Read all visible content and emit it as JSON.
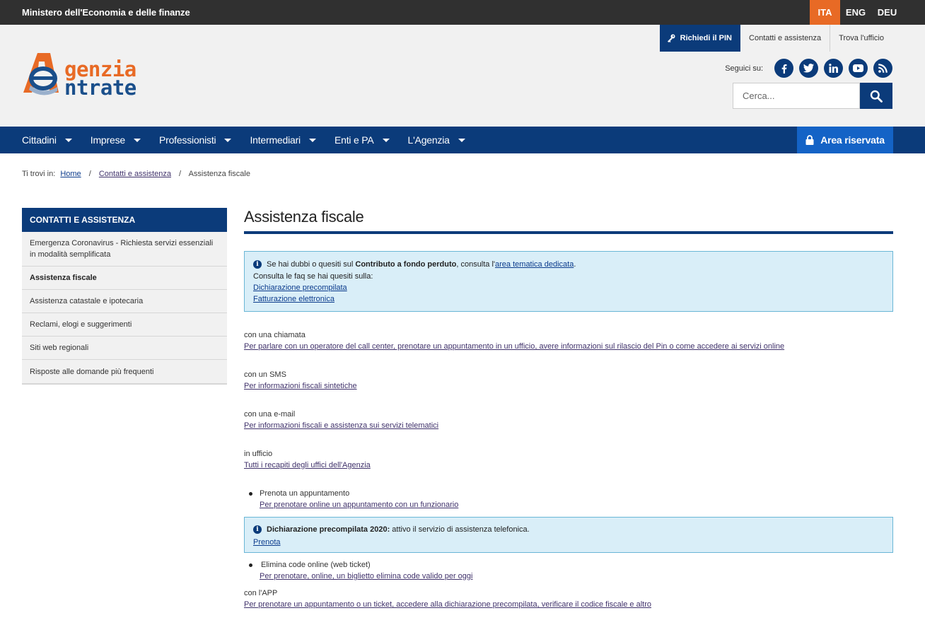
{
  "topbar": {
    "ministry": "Ministero dell'Economia e delle finanze",
    "languages": [
      "ITA",
      "ENG",
      "DEU"
    ],
    "active_color": "#e86a25"
  },
  "logo": {
    "part1": "genzia",
    "part2": "ntrate"
  },
  "util": {
    "pin": "Richiedi il PIN",
    "contacts": "Contatti e assistenza",
    "office": "Trova l'ufficio"
  },
  "social": {
    "label": "Seguici su:",
    "icons": [
      "facebook-icon",
      "twitter-icon",
      "linkedin-icon",
      "youtube-icon",
      "rss-icon"
    ]
  },
  "search": {
    "placeholder": "Cerca..."
  },
  "nav": {
    "items": [
      "Cittadini",
      "Imprese",
      "Professionisti",
      "Intermediari",
      "Enti e PA",
      "L'Agenzia"
    ],
    "area": "Area riservata"
  },
  "breadcrumb": {
    "prefix": "Ti trovi in:",
    "home": "Home",
    "section": "Contatti e assistenza",
    "current": "Assistenza fiscale",
    "separator": "/"
  },
  "sidebar": {
    "title": "CONTATTI E ASSISTENZA",
    "items": [
      "Emergenza Coronavirus - Richiesta servizi essenziali in modalità semplificata",
      "Assistenza fiscale",
      "Assistenza catastale e ipotecaria",
      "Reclami, elogi e suggerimenti",
      "Siti web regionali",
      "Risposte alle domande più frequenti"
    ]
  },
  "content": {
    "title": "Assistenza fiscale",
    "info1": {
      "pre": "Se hai dubbi o quesiti sul ",
      "bold": "Contributo a fondo perduto",
      "mid": ", consulta l'",
      "link": "area tematica dedicata",
      "post": ".",
      "faq_intro": "Consulta le faq se hai quesiti sulla:",
      "faq1": "Dichiarazione precompilata",
      "faq2": "Fatturazione elettronica"
    },
    "blocks": [
      {
        "label": "con una chiamata",
        "link": "Per parlare con un operatore del call center, prenotare un appuntamento in un ufficio, avere informazioni sul rilascio del Pin o come accedere ai servizi online"
      },
      {
        "label": "con un SMS",
        "link": "Per informazioni fiscali sintetiche"
      },
      {
        "label": "con una e-mail",
        "link": "Per informazioni fiscali e assistenza sui servizi telematici"
      },
      {
        "label": "in ufficio",
        "link": "Tutti i recapiti degli uffici dell'Agenzia"
      }
    ],
    "bullet1": {
      "label": "Prenota un appuntamento",
      "link": "Per prenotare online un appuntamento con un funzionario"
    },
    "info2": {
      "bold": "Dichiarazione precompilata 2020:",
      "text": " attivo il servizio di assistenza telefonica.",
      "link": "Prenota"
    },
    "bullet2": {
      "label": "Elimina code online (web ticket)",
      "link": "Per prenotare, online, un biglietto elimina code valido per oggi"
    },
    "app": {
      "label": "con l'APP",
      "link": "Per prenotare un appuntamento o un ticket, accedere alla dichiarazione precompilata, verificare il codice fiscale e altro"
    }
  }
}
